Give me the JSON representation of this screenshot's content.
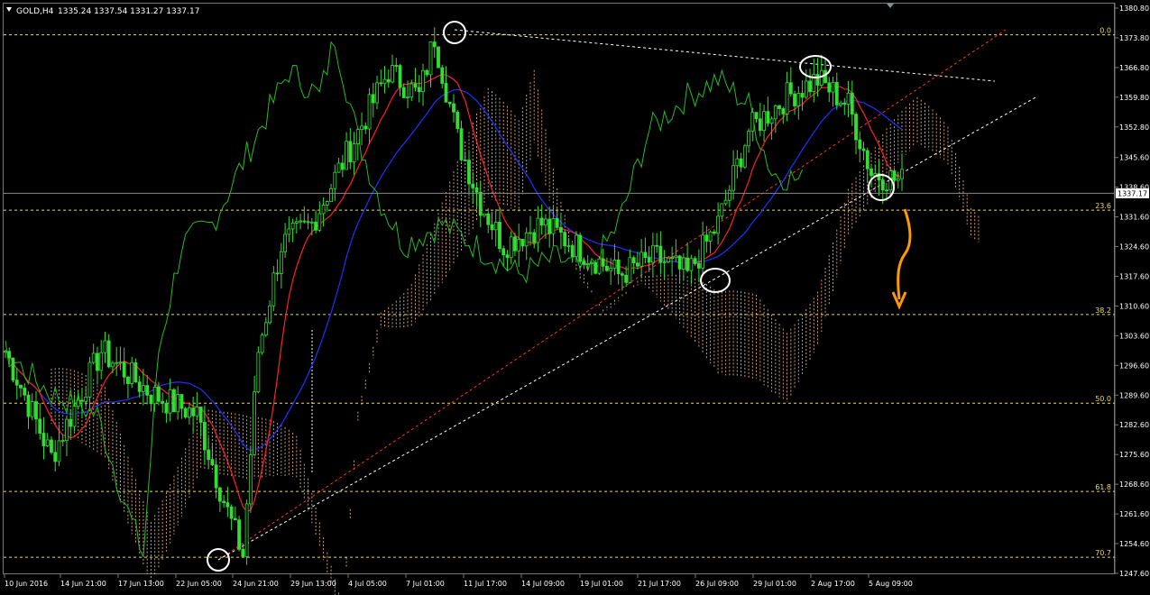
{
  "header": {
    "symbol": "GOLD,H4",
    "ohlc": "1335.24 1337.54 1331.27 1337.17"
  },
  "current_price_label": "1337.17",
  "colors": {
    "background": "#000000",
    "candles": "#33dd33",
    "chikou": "#22bb22",
    "tenkan": "#ff2020",
    "kijun": "#2030ff",
    "cloud": "#f0b890",
    "fib": "#e8d870",
    "trend_red": "#ff3030",
    "trend_white": "#ffffff",
    "arrow": "#ff9900",
    "axis_text": "#ffffff"
  },
  "icons": [
    "triangle-down-icon",
    "arrow-down-icon",
    "circle-marker-icon"
  ],
  "chart_data": {
    "type": "candlestick",
    "ylim": [
      1247.6,
      1380.8
    ],
    "price_ticks": [
      "1380.80",
      "1373.80",
      "1366.80",
      "1359.80",
      "1352.80",
      "1345.60",
      "1338.60",
      "1331.60",
      "1324.60",
      "1317.60",
      "1310.60",
      "1303.60",
      "1296.60",
      "1289.60",
      "1282.60",
      "1275.60",
      "1268.60",
      "1261.60",
      "1254.60",
      "1247.60"
    ],
    "time_ticks": [
      "10 Jun 2016",
      "14 Jun 21:00",
      "17 Jun 13:00",
      "22 Jun 05:00",
      "24 Jun 21:00",
      "29 Jun 13:00",
      "4 Jul 05:00",
      "7 Jul 01:00",
      "11 Jul 17:00",
      "14 Jul 09:00",
      "19 Jul 01:00",
      "21 Jul 17:00",
      "26 Jul 09:00",
      "29 Jul 01:00",
      "2 Aug 17:00",
      "5 Aug 09:00"
    ],
    "fib_levels": [
      {
        "label": "0.0",
        "price": 1374.5
      },
      {
        "label": "23.6",
        "price": 1333.2
      },
      {
        "label": "38.2",
        "price": 1308.6
      },
      {
        "label": "50.0",
        "price": 1287.7
      },
      {
        "label": "61.8",
        "price": 1266.9
      },
      {
        "label": "70.7",
        "price": 1251.4
      }
    ],
    "current_price": 1337.17,
    "approx_close_path": [
      [
        0,
        1300
      ],
      [
        12,
        1275
      ],
      [
        25,
        1300
      ],
      [
        38,
        1290
      ],
      [
        50,
        1285
      ],
      [
        58,
        1262
      ],
      [
        62,
        1252
      ],
      [
        66,
        1300
      ],
      [
        72,
        1325
      ],
      [
        80,
        1330
      ],
      [
        90,
        1348
      ],
      [
        100,
        1366
      ],
      [
        108,
        1360
      ],
      [
        112,
        1374
      ],
      [
        118,
        1350
      ],
      [
        124,
        1335
      ],
      [
        130,
        1325
      ],
      [
        140,
        1330
      ],
      [
        150,
        1324
      ],
      [
        160,
        1318
      ],
      [
        170,
        1322
      ],
      [
        178,
        1318
      ],
      [
        186,
        1330
      ],
      [
        194,
        1352
      ],
      [
        204,
        1360
      ],
      [
        212,
        1364
      ],
      [
        220,
        1358
      ],
      [
        226,
        1342
      ],
      [
        234,
        1340
      ]
    ]
  }
}
